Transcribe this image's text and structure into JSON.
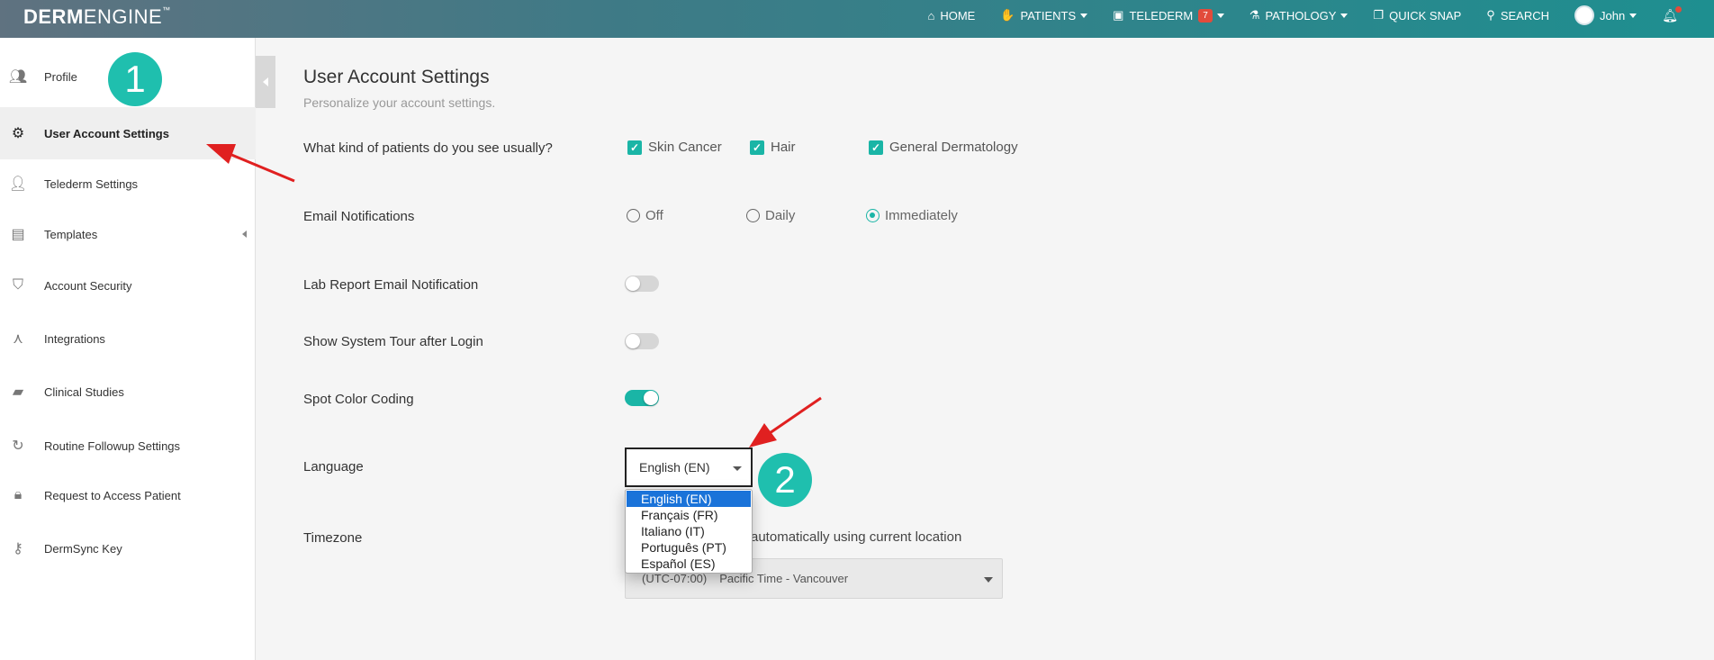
{
  "brand": {
    "left": "DERM",
    "right": "ENGINE",
    "tm": "™"
  },
  "nav": {
    "home": "HOME",
    "patients": "PATIENTS",
    "telederm": "TELEDERM",
    "telederm_badge": "7",
    "pathology": "PATHOLOGY",
    "quick_snap": "QUICK SNAP",
    "search": "SEARCH",
    "user": "John"
  },
  "sidebar": {
    "items": [
      {
        "label": "Profile",
        "icon": "people-icon"
      },
      {
        "label": "User Account Settings",
        "icon": "gear-icon"
      },
      {
        "label": "Telederm Settings",
        "icon": "telederm-icon"
      },
      {
        "label": "Templates",
        "icon": "document-icon"
      },
      {
        "label": "Account Security",
        "icon": "shield-icon"
      },
      {
        "label": "Integrations",
        "icon": "integrations-icon"
      },
      {
        "label": "Clinical Studies",
        "icon": "folder-user-icon"
      },
      {
        "label": "Routine Followup Settings",
        "icon": "history-icon"
      },
      {
        "label": "Request to Access Patient",
        "icon": "lock-icon"
      },
      {
        "label": "DermSync Key",
        "icon": "key-icon"
      }
    ]
  },
  "main": {
    "title": "User Account Settings",
    "subtitle": "Personalize your account settings.",
    "patients_q": "What kind of patients do you see usually?",
    "patient_types": [
      "Skin Cancer",
      "Hair",
      "General Dermatology"
    ],
    "email_label": "Email Notifications",
    "email_options": [
      "Off",
      "Daily",
      "Immediately"
    ],
    "email_selected": "Immediately",
    "lab_label": "Lab Report Email Notification",
    "tour_label": "Show System Tour after Login",
    "spot_label": "Spot Color Coding",
    "language_label": "Language",
    "language_value": "English (EN)",
    "language_options": [
      "English (EN)",
      "Français (FR)",
      "Italiano (IT)",
      "Português (PT)",
      "Español (ES)"
    ],
    "timezone_label": "Timezone",
    "timezone_auto": "automatically using current location",
    "timezone_offset": "(UTC-07:00)",
    "timezone_value": "Pacific Time - Vancouver"
  },
  "annotations": {
    "step1": "1",
    "step2": "2"
  },
  "colors": {
    "accent": "#1ab5a6",
    "arrow": "#e02020",
    "selected_option": "#1a73d9"
  }
}
